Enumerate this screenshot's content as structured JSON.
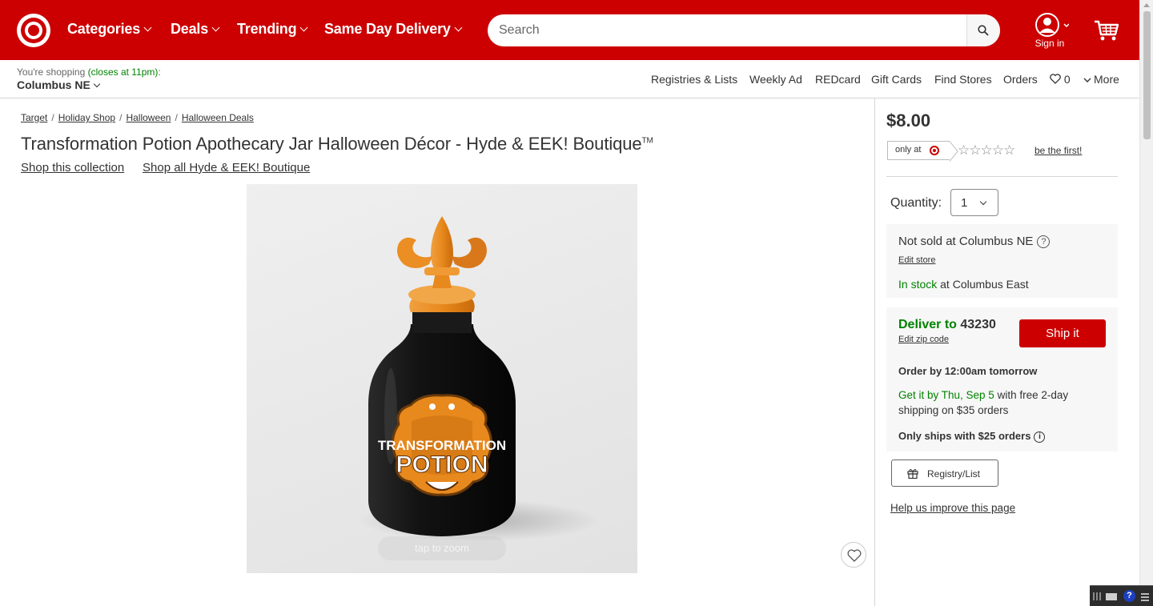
{
  "header": {
    "nav": [
      {
        "label": "Categories"
      },
      {
        "label": "Deals"
      },
      {
        "label": "Trending"
      },
      {
        "label": "Same Day Delivery"
      }
    ],
    "search_placeholder": "Search",
    "sign_in": "Sign in",
    "colors": {
      "brand_red": "#cc0000"
    }
  },
  "store_bar": {
    "shopping_prefix": "You're shopping",
    "closes": "(closes at 11pm)",
    "colon": ":",
    "store": "Columbus NE",
    "links": [
      "Registries & Lists",
      "Weekly Ad",
      "REDcard",
      "Gift Cards",
      "Find Stores",
      "Orders"
    ],
    "favorites_count": "0",
    "more": "More"
  },
  "breadcrumbs": [
    "Target",
    "Holiday Shop",
    "Halloween",
    "Halloween Deals"
  ],
  "product": {
    "title": "Transformation Potion Apothecary Jar Halloween Décor - Hyde & EEK! Boutique",
    "trademark": "TM",
    "collection_link": "Shop this collection",
    "brand_link": "Shop all Hyde & EEK! Boutique",
    "image_label_line1": "TRANSFORMATION",
    "image_label_line2": "POTION",
    "tap_to_zoom": "tap to zoom"
  },
  "buybox": {
    "price": "$8.00",
    "only_at": "only at",
    "rating_stars": 0,
    "be_first": "be the first!",
    "quantity_label": "Quantity:",
    "quantity_value": "1",
    "not_sold": "Not sold at Columbus NE",
    "edit_store": "Edit store",
    "in_stock": "In stock",
    "in_stock_location": " at Columbus East",
    "deliver_to": "Deliver to",
    "zip": "43230",
    "edit_zip": "Edit zip code",
    "ship_button": "Ship it",
    "order_by": "Order by 12:00am tomorrow",
    "get_it": "Get it by Thu, Sep 5",
    "shipping_note": " with free 2-day shipping on $35 orders",
    "only_ships": "Only ships with $25 orders",
    "registry_button": "Registry/List",
    "help_link": "Help us improve this page"
  }
}
